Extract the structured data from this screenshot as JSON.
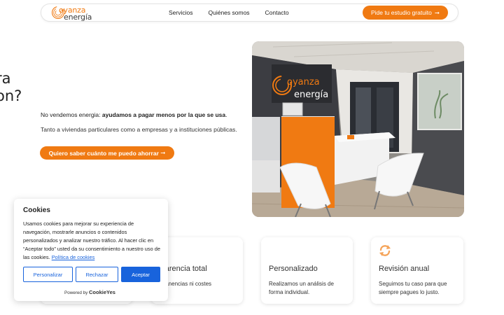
{
  "header": {
    "logo": {
      "line1": "oyanza",
      "line2": "energía"
    },
    "nav": [
      "Servicios",
      "Quiénes somos",
      "Contacto"
    ],
    "cta": {
      "label": "Pide tu estudio gratuito",
      "arrow": "➞"
    }
  },
  "hero": {
    "heading_fragments": [
      "ra",
      "on?"
    ],
    "lead_prefix": "No vendemos energia: ",
    "lead_bold": "ayudamos a pagar menos por la que se usa",
    "lead_suffix": ".",
    "subtext": "Tanto a viviendas particulares como a empresas y a instituciones públicas.",
    "cta": {
      "label": "Quiero saber cuánto me puedo ahorrar",
      "arrow": "➞"
    },
    "photo_sign": {
      "line1": "oyanza",
      "line2": "energía"
    }
  },
  "features": [
    {
      "title": "nsparencia total",
      "desc_line1": "permanencias ni costes",
      "desc_line2": "ltos.",
      "icon": "transparency-icon"
    },
    {
      "title": "Personalizado",
      "desc_line1": "Realizamos un análisis de",
      "desc_line2": "forma individual.",
      "icon": ""
    },
    {
      "title": "Revisión anual",
      "desc_line1": "Seguimos tu caso para que",
      "desc_line2": "siempre pagues lo justo.",
      "icon": "refresh-icon"
    }
  ],
  "cookie_banner": {
    "title": "Cookies",
    "body": "Usamos cookies para mejorar su experiencia de navegación, mostrarle anuncios o contenidos personalizados y analizar nuestro tráfico. Al hacer clic en “Aceptar todo” usted da su consentimiento a nuestro uso de las cookies.",
    "policy_link": "Política de cookies",
    "buttons": {
      "customize": "Personalizar",
      "reject": "Rechazar",
      "accept": "Aceptar"
    },
    "powered_prefix": "Powered by",
    "powered_brand": "CookieYes"
  },
  "colors": {
    "accent": "#f07a12",
    "cookie_blue": "#1863dc"
  }
}
